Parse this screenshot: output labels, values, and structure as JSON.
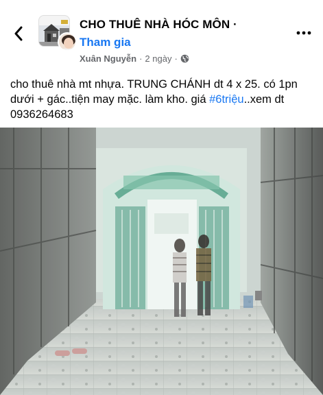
{
  "header": {
    "group_name": "CHO THUÊ NHÀ HÓC MÔN ·",
    "join_label": "Tham gia",
    "author": "Xuân Nguyễn",
    "separator": "·",
    "time": "2 ngày",
    "separator2": "·"
  },
  "icons": {
    "back": "chevron-left-icon",
    "more": "more-dots-icon",
    "privacy": "globe-icon"
  },
  "post": {
    "text_before": "cho thuê nhà mt nhựa. TRUNG CHÁNH  dt 4 x 25. có 1pn dưới + gác..tiện may mặc. làm kho. giá ",
    "hashtag": "#6triệu",
    "text_after": "..xem dt 0936264683"
  },
  "colors": {
    "link_blue": "#1877f2",
    "meta_gray": "#65676b",
    "text": "#050505"
  }
}
